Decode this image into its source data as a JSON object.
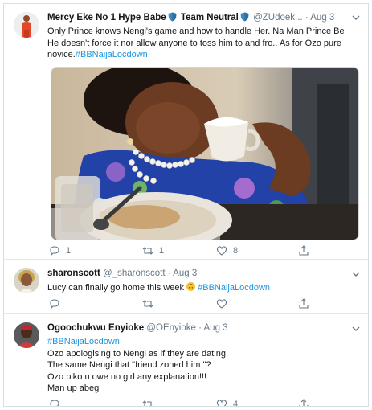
{
  "tweets": [
    {
      "name": "Mercy Eke No 1 Hype Babe",
      "separator_name": "Team Neutral",
      "handle": "@ZUdoek...",
      "dot": "·",
      "time": "Aug 3",
      "text_lines": [
        "Only Prince knows Nengi's game and how to handle Her. Na Man Prince Be",
        "He doesn't force it nor allow anyone to toss him to and fro.. As for Ozo pure",
        "novice."
      ],
      "hashtag": "#BBNaijaLocdown",
      "reply_count": "1",
      "retweet_count": "1",
      "like_count": "8",
      "media_icon": "photo-girl-drinking-cup"
    },
    {
      "name": "sharonscott",
      "handle": "@_sharonscott",
      "dot": "·",
      "time": "Aug 3",
      "text": "Lucy can finally go home this week",
      "emoji_icon": "upside-down-face-emoji",
      "hashtag": "#BBNaijaLocdown",
      "reply_count": "",
      "retweet_count": "",
      "like_count": ""
    },
    {
      "name": "Ogoochukwu Enyioke",
      "handle": "@OEnyioke",
      "dot": "·",
      "time": "Aug 3",
      "hashtag": "#BBNaijaLocdown",
      "text_lines": [
        "Ozo apologising to Nengi as if they are dating.",
        "The same Nengi that \"friend zoned him \"?",
        "Ozo biko u owe no girl any explanation!!!",
        "Man up abeg"
      ],
      "like_count": "4"
    }
  ],
  "colors": {
    "link": "#1b95e0",
    "shield": "#3b88c3",
    "secondary": "#657786"
  }
}
